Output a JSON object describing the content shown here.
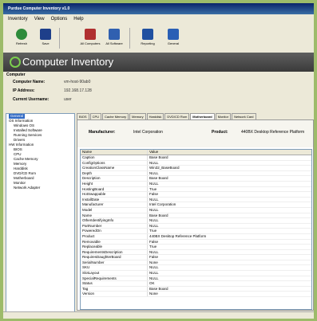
{
  "window": {
    "title": "Purdue Computer Inventory v1.0"
  },
  "menu": [
    "Inventory",
    "View",
    "Options",
    "Help"
  ],
  "toolbar": [
    {
      "label": "Refresh",
      "icon": "refresh-icon",
      "color": "#2e8b3a"
    },
    {
      "label": "Save",
      "icon": "save-icon",
      "color": "#1e3f8a"
    },
    {
      "label": "All Computers",
      "icon": "computers-icon",
      "color": "#b03030"
    },
    {
      "label": "All Software",
      "icon": "software-icon",
      "color": "#3060b0"
    },
    {
      "label": "Reporting",
      "icon": "reporting-icon",
      "color": "#2050a0"
    },
    {
      "label": "General",
      "icon": "general-icon",
      "color": "#2a5fb5"
    }
  ],
  "banner": {
    "title": "Computer Inventory"
  },
  "info": {
    "section": "Computer",
    "fields": [
      {
        "label": "Computer Name:",
        "value": "vm-host-90ab0"
      },
      {
        "label": "IP Address:",
        "value": "192.168.17.128"
      },
      {
        "label": "Current Username:",
        "value": "user"
      }
    ]
  },
  "tree": [
    {
      "label": "General",
      "selected": true,
      "indent": 0
    },
    {
      "label": "OS Information",
      "indent": 0
    },
    {
      "label": "Windows OS",
      "indent": 1
    },
    {
      "label": "Installed Software",
      "indent": 1
    },
    {
      "label": "Running Services",
      "indent": 1
    },
    {
      "label": "Drivers",
      "indent": 1
    },
    {
      "label": "HW Information",
      "indent": 0
    },
    {
      "label": "BIOS",
      "indent": 1
    },
    {
      "label": "CPU",
      "indent": 1
    },
    {
      "label": "Cache Memory",
      "indent": 1
    },
    {
      "label": "Memory",
      "indent": 1
    },
    {
      "label": "Harddisk",
      "indent": 1
    },
    {
      "label": "DVD/CD Rom",
      "indent": 1
    },
    {
      "label": "Motherboard",
      "indent": 1
    },
    {
      "label": "Monitor",
      "indent": 1
    },
    {
      "label": "Network Adapter",
      "indent": 1
    }
  ],
  "tabs": [
    {
      "label": "BIOS"
    },
    {
      "label": "CPU"
    },
    {
      "label": "Cache Memory"
    },
    {
      "label": "Memory"
    },
    {
      "label": "Harddisk"
    },
    {
      "label": "DVD/CD Rom"
    },
    {
      "label": "Motherboard",
      "active": true
    },
    {
      "label": "Monitor"
    },
    {
      "label": "Network Card"
    }
  ],
  "summary": {
    "manufacturer_label": "Manufacturer:",
    "manufacturer_value": "Intel Corporation",
    "product_label": "Product:",
    "product_value": "440BX Desktop Reference Platform"
  },
  "grid": {
    "headers": [
      "Name",
      "Value"
    ],
    "rows": [
      [
        "Caption",
        "Base Board"
      ],
      [
        "ConfigOptions",
        "NULL"
      ],
      [
        "CreationClassName",
        "Win32_BaseBoard"
      ],
      [
        "Depth",
        "NULL"
      ],
      [
        "Description",
        "Base Board"
      ],
      [
        "Height",
        "NULL"
      ],
      [
        "HostingBoard",
        "True"
      ],
      [
        "HotSwappable",
        "False"
      ],
      [
        "InstallDate",
        "NULL"
      ],
      [
        "Manufacturer",
        "Intel Corporation"
      ],
      [
        "Model",
        "NULL"
      ],
      [
        "Name",
        "Base Board"
      ],
      [
        "OtherIdentifyingInfo",
        "NULL"
      ],
      [
        "PartNumber",
        "NULL"
      ],
      [
        "PoweredOn",
        "True"
      ],
      [
        "Product",
        "440BX Desktop Reference Platform"
      ],
      [
        "Removable",
        "False"
      ],
      [
        "Replaceable",
        "True"
      ],
      [
        "RequirementsDescription",
        "NULL"
      ],
      [
        "RequiresDaughterBoard",
        "False"
      ],
      [
        "SerialNumber",
        "None"
      ],
      [
        "SKU",
        "NULL"
      ],
      [
        "SlotLayout",
        "NULL"
      ],
      [
        "SpecialRequirements",
        "NULL"
      ],
      [
        "Status",
        "OK"
      ],
      [
        "Tag",
        "Base Board"
      ],
      [
        "Version",
        "None"
      ]
    ]
  }
}
